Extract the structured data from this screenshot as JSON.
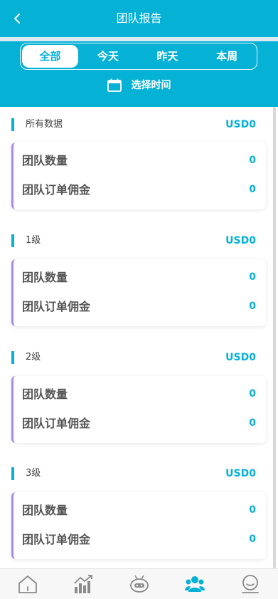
{
  "header": {
    "title": "团队报告",
    "back_icon": "chevron-left-icon"
  },
  "filters": {
    "tabs": [
      {
        "label": "全部",
        "active": true
      },
      {
        "label": "今天",
        "active": false
      },
      {
        "label": "昨天",
        "active": false
      },
      {
        "label": "本周",
        "active": false
      }
    ],
    "date_picker": {
      "icon": "calendar-icon",
      "label": "选择时间"
    }
  },
  "sections": [
    {
      "name": "所有数据",
      "amount": "USD0",
      "rows": [
        {
          "label": "团队数量",
          "value": "0"
        },
        {
          "label": "团队订单佣金",
          "value": "0"
        }
      ]
    },
    {
      "name": "1级",
      "amount": "USD0",
      "rows": [
        {
          "label": "团队数量",
          "value": "0"
        },
        {
          "label": "团队订单佣金",
          "value": "0"
        }
      ]
    },
    {
      "name": "2级",
      "amount": "USD0",
      "rows": [
        {
          "label": "团队数量",
          "value": "0"
        },
        {
          "label": "团队订单佣金",
          "value": "0"
        }
      ]
    },
    {
      "name": "3级",
      "amount": "USD0",
      "rows": [
        {
          "label": "团队数量",
          "value": "0"
        },
        {
          "label": "团队订单佣金",
          "value": "0"
        }
      ]
    }
  ],
  "bottom_nav": [
    {
      "icon": "home-icon",
      "active": false
    },
    {
      "icon": "chart-icon",
      "active": false
    },
    {
      "icon": "robot-icon",
      "active": false
    },
    {
      "icon": "team-icon",
      "active": true
    },
    {
      "icon": "profile-icon",
      "active": false
    }
  ],
  "colors": {
    "primary": "#06b1d6",
    "card_accent": "#a78be0",
    "icon_gray": "#8a8a8a"
  }
}
